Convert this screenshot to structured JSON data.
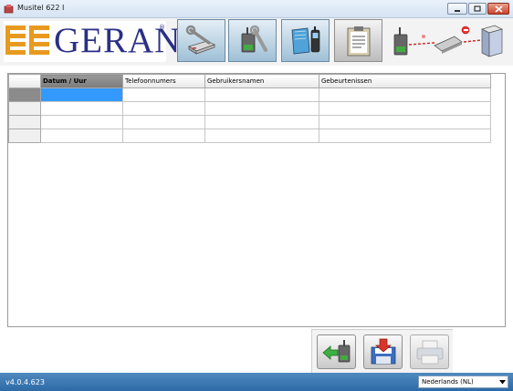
{
  "window": {
    "title": "Musitel 622 I",
    "icon": "app-icon"
  },
  "window_controls": {
    "minimize": "minimize-icon",
    "maximize": "maximize-icon",
    "close": "close-icon"
  },
  "header": {
    "logo_text": "GERAN",
    "logo_reg": "®",
    "toolbar": [
      {
        "name": "settings-button",
        "icon": "wrench-modem-icon"
      },
      {
        "name": "device-config-button",
        "icon": "device-wrench-icon"
      },
      {
        "name": "phonebook-button",
        "icon": "book-phone-icon"
      },
      {
        "name": "log-button",
        "icon": "clipboard-icon"
      }
    ],
    "connection_icon": "connection-status-icon"
  },
  "table": {
    "columns": [
      "Datum / Uur",
      "Telefoonnumers",
      "Gebruikersnamen",
      "Gebeurtenissen"
    ],
    "rows": [
      [
        "",
        "",
        "",
        ""
      ],
      [
        "",
        "",
        "",
        ""
      ],
      [
        "",
        "",
        "",
        ""
      ],
      [
        "",
        "",
        "",
        ""
      ]
    ]
  },
  "bottom_toolbar": {
    "read_button": "download-from-device-icon",
    "save_button": "save-icon",
    "print_button": "printer-icon"
  },
  "status": {
    "version": "v4.0.4.623",
    "language": "Nederlands (NL)"
  },
  "colors": {
    "accent": "#3399ff",
    "status_bar": "#2d6aa5",
    "logo": "#2a2f86"
  }
}
